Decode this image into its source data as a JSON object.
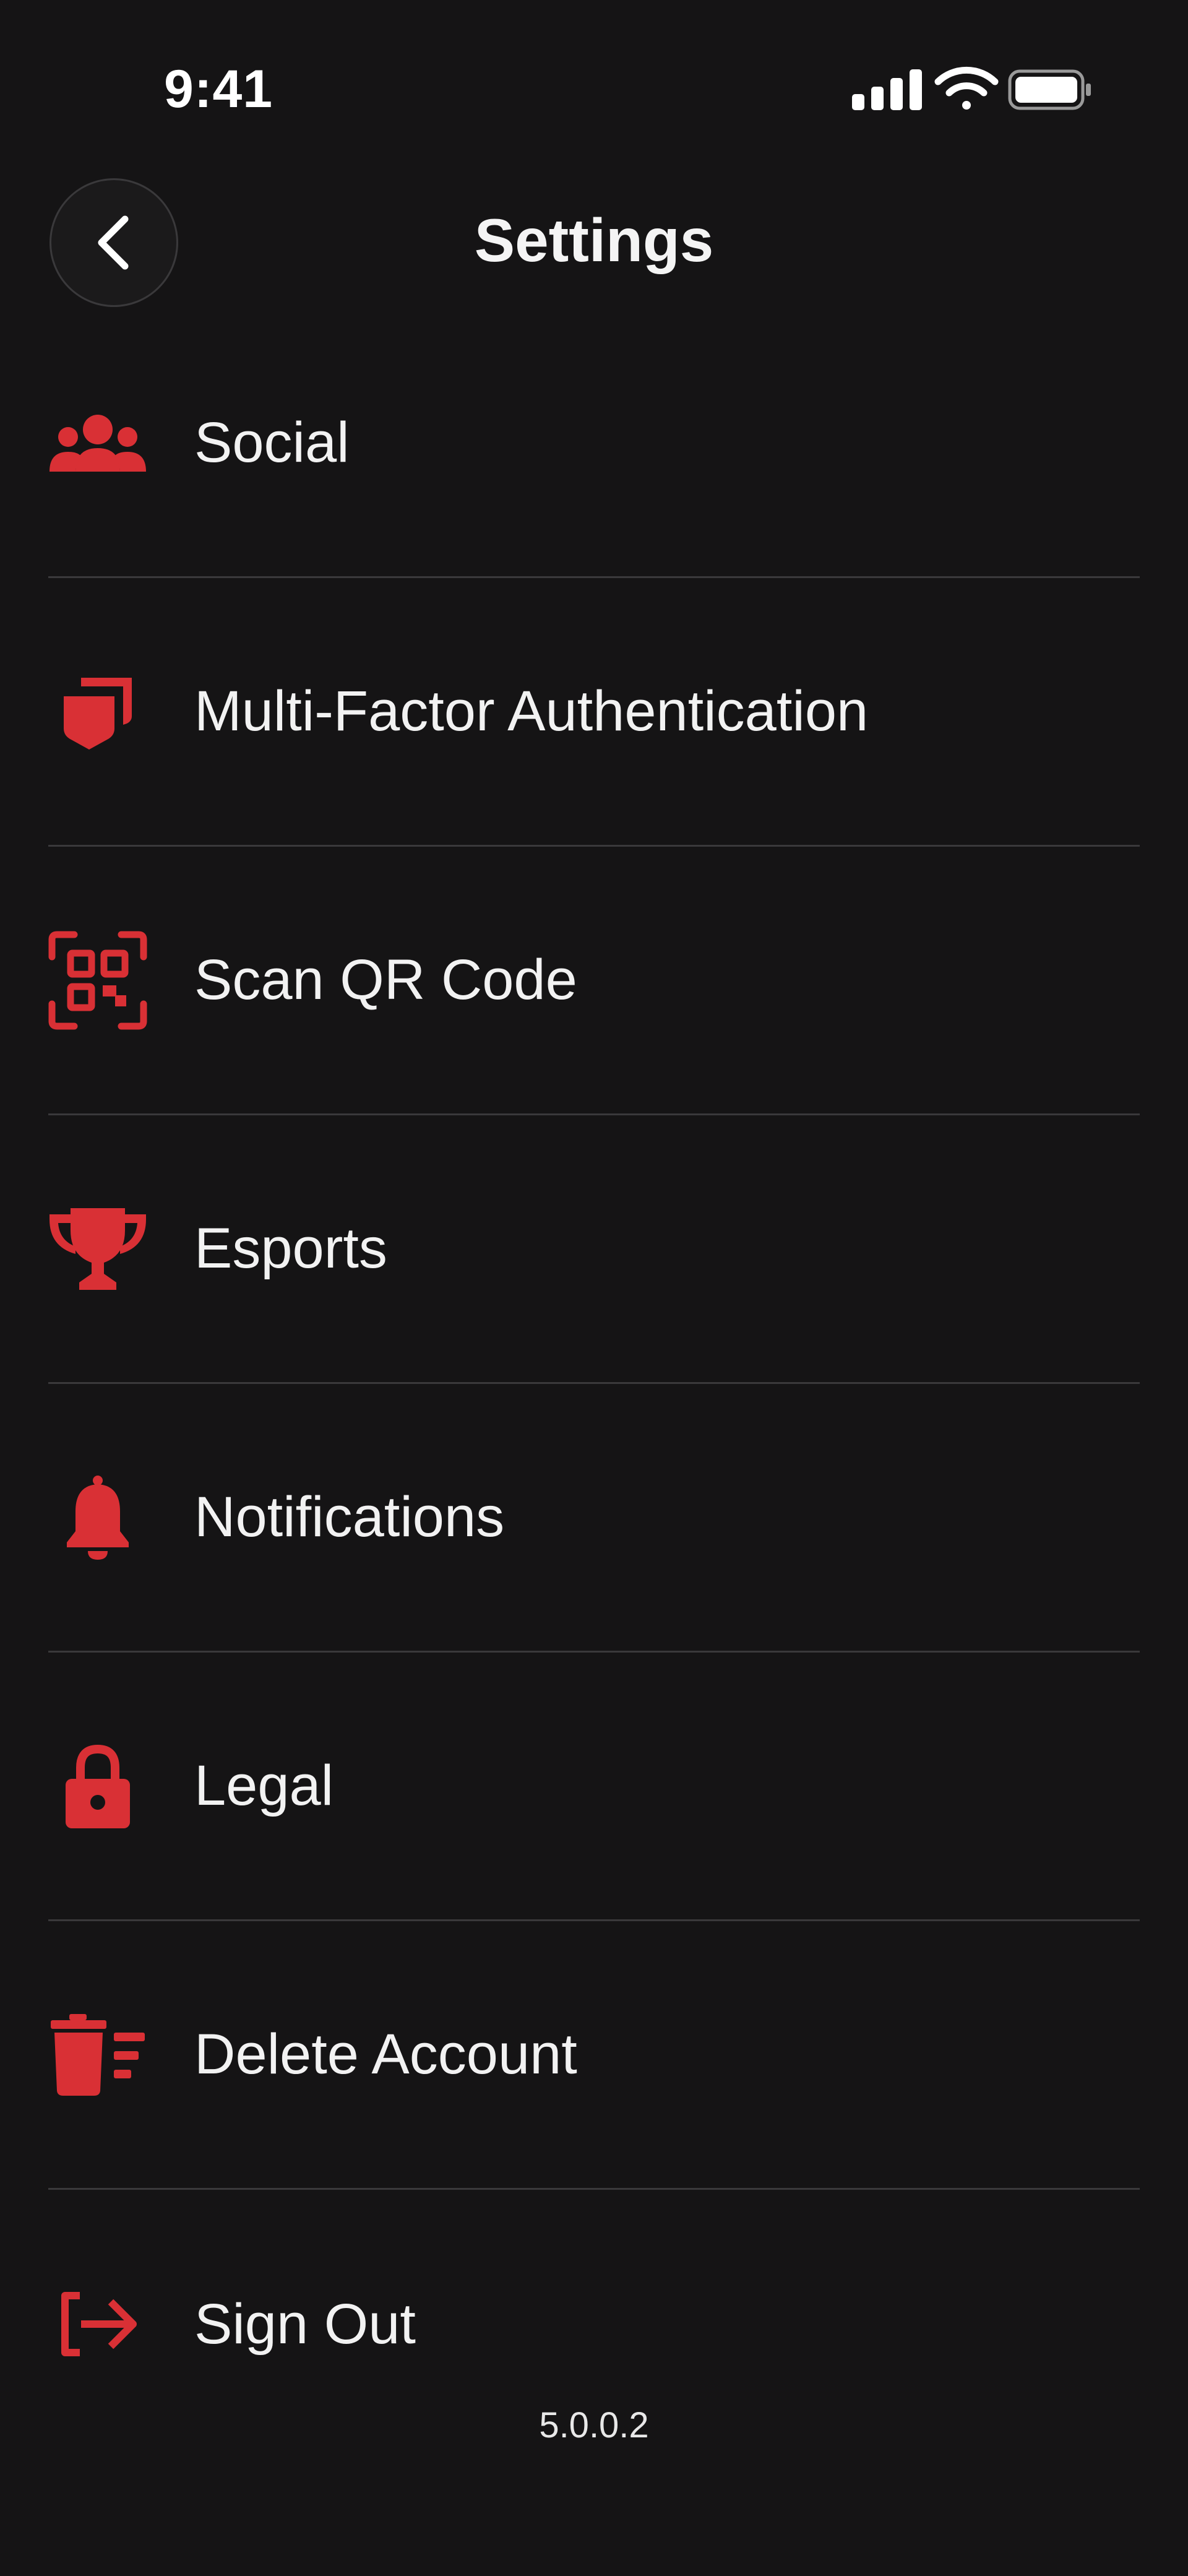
{
  "status_bar": {
    "time": "9:41",
    "icons": [
      "cellular-signal-icon",
      "wifi-icon",
      "battery-icon"
    ]
  },
  "header": {
    "title": "Settings",
    "back_icon": "chevron-left-icon"
  },
  "menu": {
    "items": [
      {
        "label": "Social",
        "icon": "users-group-icon"
      },
      {
        "label": "Multi-Factor Authentication",
        "icon": "shield-icon"
      },
      {
        "label": "Scan QR Code",
        "icon": "qr-code-icon"
      },
      {
        "label": "Esports",
        "icon": "trophy-icon"
      },
      {
        "label": "Notifications",
        "icon": "bell-icon"
      },
      {
        "label": "Legal",
        "icon": "lock-icon"
      },
      {
        "label": "Delete Account",
        "icon": "trash-list-icon"
      },
      {
        "label": "Sign Out",
        "icon": "sign-out-icon"
      }
    ]
  },
  "footer": {
    "version": "5.0.0.2"
  },
  "colors": {
    "background": "#151415",
    "accent": "#d93035",
    "text": "#f2f2f2",
    "divider": "#3a393b"
  }
}
